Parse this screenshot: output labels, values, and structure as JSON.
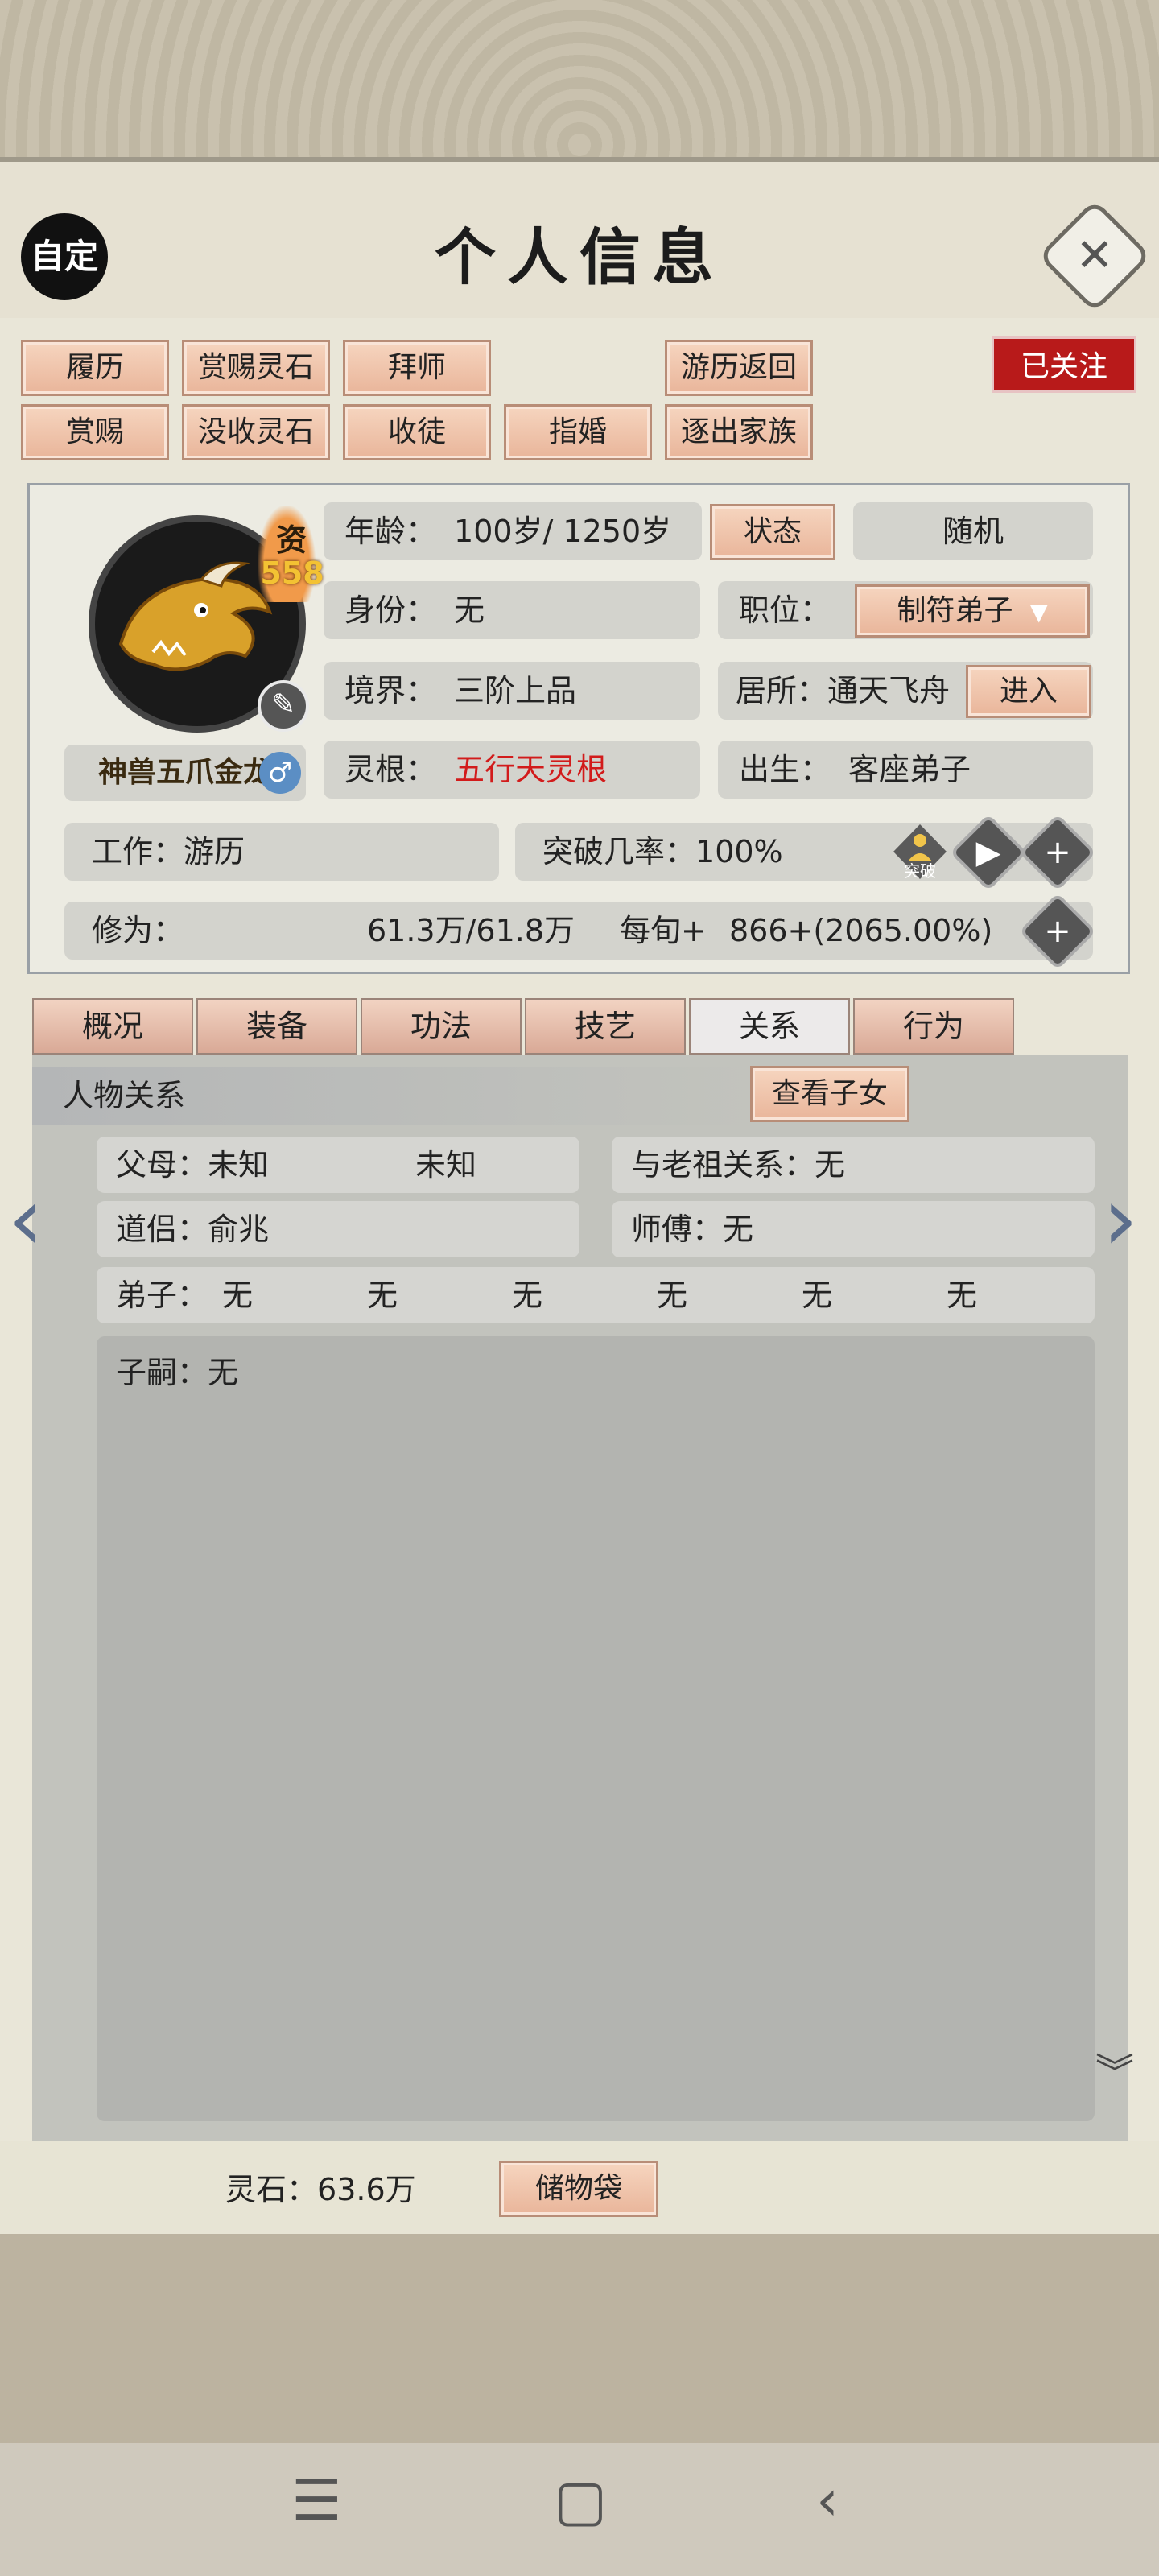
{
  "header": {
    "title": "个人信息",
    "custom_label": "自定",
    "close_symbol": "✕"
  },
  "actions": {
    "row1": [
      "履历",
      "赏赐灵石",
      "拜师",
      "游历返回"
    ],
    "row2": [
      "赏赐",
      "没收灵石",
      "收徒",
      "指婚",
      "逐出家族"
    ],
    "followed": "已关注"
  },
  "character": {
    "aptitude_label": "资",
    "aptitude_value": "558",
    "name": "神兽五爪金龙",
    "gender_symbol": "♂",
    "age_label": "年龄：",
    "age_value": "100岁/ 1250岁",
    "status_button": "状态",
    "random_label": "随机",
    "identity_label": "身份：",
    "identity_value": "无",
    "position_label": "职位：",
    "position_value": "制符弟子",
    "realm_label": "境界：",
    "realm_value": "三阶上品",
    "residence_label": "居所：",
    "residence_value": "通天飞舟",
    "enter_button": "进入",
    "root_label": "灵根：",
    "root_value": "五行天灵根",
    "birth_label": "出生：",
    "birth_value": "客座弟子",
    "work_label": "工作：",
    "work_value": "游历",
    "breakthrough_label": "突破几率：",
    "breakthrough_value": "100%",
    "breakthrough_icon_text": "突破",
    "cultivation_label": "修为：",
    "cultivation_value": "61.3万/61.8万",
    "per_turn_label": "每旬+",
    "per_turn_value": "866+(2065.00%)"
  },
  "tabs": [
    "概况",
    "装备",
    "功法",
    "技艺",
    "关系",
    "行为"
  ],
  "relations": {
    "header": "人物关系",
    "view_children": "查看子女",
    "parents_label": "父母：",
    "parent1": "未知",
    "parent2": "未知",
    "ancestor_label": "与老祖关系：",
    "ancestor_value": "无",
    "partner_label": "道侣：",
    "partner_value": "俞兆",
    "master_label": "师傅：",
    "master_value": "无",
    "disciples_label": "弟子：",
    "disciples": [
      "无",
      "无",
      "无",
      "无",
      "无",
      "无"
    ],
    "heirs_label": "子嗣：",
    "heirs_value": "无"
  },
  "footer": {
    "spirit_stone_label": "灵石：",
    "spirit_stone_value": "63.6万",
    "storage_bag": "储物袋"
  },
  "colors": {
    "accent_red": "#d21b1b",
    "button_peach": "#e9b59a",
    "badge_red": "#b81a1a"
  }
}
